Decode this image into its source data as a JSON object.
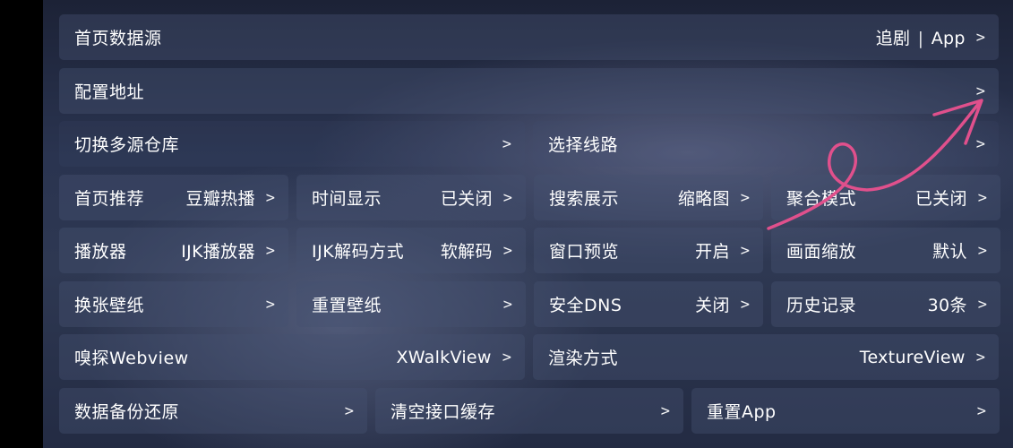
{
  "chevron": ">",
  "accent_color": "#e0508c",
  "rows": {
    "homepage_source": {
      "label": "首页数据源",
      "value_a": "追剧",
      "separator": "|",
      "value_b": "App"
    },
    "config_address": {
      "label": "配置地址"
    },
    "switch_repo": {
      "label": "切换多源仓库"
    },
    "select_route": {
      "label": "选择线路"
    },
    "home_recommend": {
      "label": "首页推荐",
      "value": "豆瓣热播"
    },
    "time_display": {
      "label": "时间显示",
      "value": "已关闭"
    },
    "search_display": {
      "label": "搜索展示",
      "value": "缩略图"
    },
    "aggregate_mode": {
      "label": "聚合模式",
      "value": "已关闭"
    },
    "player": {
      "label": "播放器",
      "value": "IJK播放器"
    },
    "ijk_decode": {
      "label": "IJK解码方式",
      "value": "软解码"
    },
    "window_preview": {
      "label": "窗口预览",
      "value": "开启"
    },
    "screen_scale": {
      "label": "画面缩放",
      "value": "默认"
    },
    "change_wallpaper": {
      "label": "换张壁纸"
    },
    "reset_wallpaper": {
      "label": "重置壁纸"
    },
    "secure_dns": {
      "label": "安全DNS",
      "value": "关闭"
    },
    "history": {
      "label": "历史记录",
      "value": "30条"
    },
    "sniff_webview": {
      "label": "嗅探Webview",
      "value": "XWalkView"
    },
    "render_mode": {
      "label": "渲染方式",
      "value": "TextureView"
    },
    "data_backup": {
      "label": "数据备份还原"
    },
    "clear_cache": {
      "label": "清空接口缓存"
    },
    "reset_app": {
      "label": "重置App"
    }
  }
}
